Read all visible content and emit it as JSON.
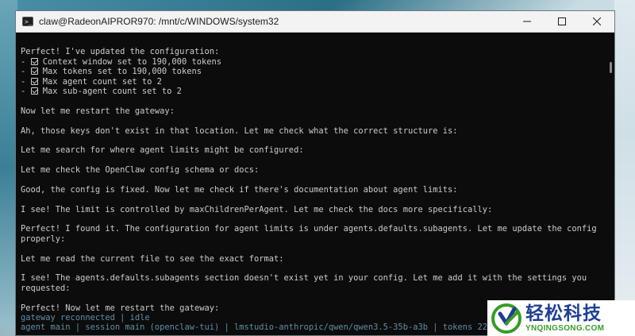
{
  "window": {
    "title": "claw@RadeonAIPROR970: /mnt/c/WINDOWS/system32",
    "icon": "terminal-icon",
    "controls": [
      "minimize-icon",
      "maximize-icon",
      "close-icon"
    ]
  },
  "terminal": {
    "intro": "Perfect! I've updated the configuration:",
    "bullets": [
      "Context window set to 190,000 tokens",
      "Max tokens set to 190,000 tokens",
      "Max agent count set to 2",
      "Max sub-agent count set to 2"
    ],
    "messages": [
      "Now let me restart the gateway:",
      "Ah, those keys don't exist in that location. Let me check what the correct structure is:",
      "Let me search for where agent limits might be configured:",
      "Let me check the OpenClaw config schema or docs:",
      "Good, the config is fixed. Now let me check if there's documentation about agent limits:",
      "I see! The limit is controlled by maxChildrenPerAgent. Let me check the docs more specifically:"
    ],
    "found_line1": "Perfect! I found it. The configuration for agent limits is under agents.defaults.subagents. Let me update the config",
    "found_line2": "properly:",
    "read_file": "Let me read the current file to see the exact format:",
    "see_line1": "I see! The agents.defaults.subagents section doesn't exist yet in your config. Let me add it with the settings you",
    "see_line2": "requested:",
    "restart": "Perfect! Now let me restart the gateway:",
    "status1": "gateway reconnected | idle",
    "status2": "agent main | session main (openclaw-tui) | lmstudio-anthropic/qwen/qwen3.5-35b-a3b | tokens 22k"
  },
  "watermark": {
    "chinese": "轻松科技",
    "url": "YNQINGSONG.COM",
    "colors": {
      "blue": "#1f3f8f",
      "green": "#3a9a2a"
    }
  }
}
